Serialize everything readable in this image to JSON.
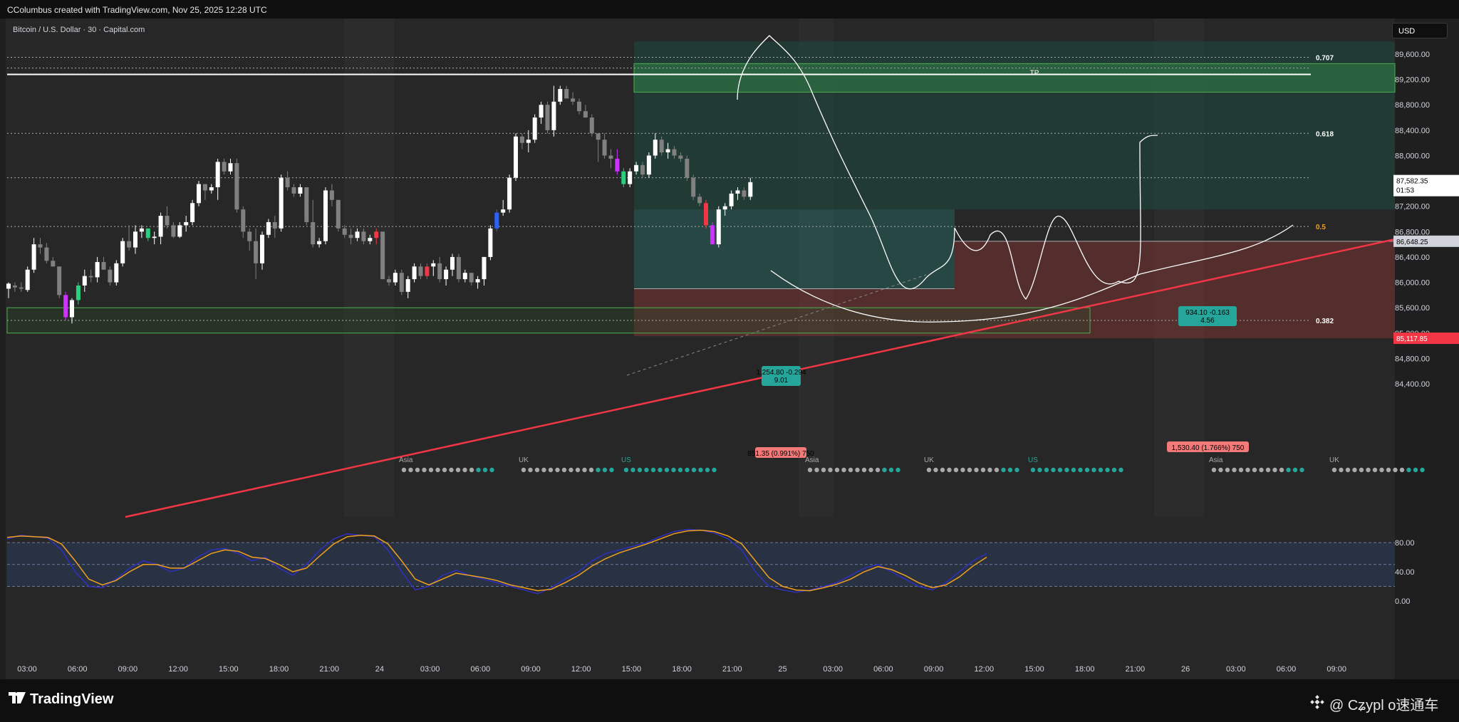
{
  "header": {
    "caption": "CColumbus created with TradingView.com, Nov 25, 2025 12:28 UTC"
  },
  "symbol_title": "Bitcoin / U.S. Dollar · 30 · Capital.com",
  "currency_button": "USD",
  "brand": {
    "name": "TradingView",
    "logo_icon": "tradingview-logo-icon"
  },
  "watermark": {
    "text": "@ Cʑypl o速通车",
    "icon": "binance-diamond-icon"
  },
  "colors": {
    "up": "#ffffff",
    "down": "#808080",
    "bull_strong": "#26d07c",
    "bear_strong": "#f23645",
    "purple": "#cc33ff",
    "blue": "#2962ff",
    "trendline": "#f23645",
    "stoch_k": "#3030c0",
    "stoch_d": "#f0a020"
  },
  "chart_data": {
    "type": "candlestick",
    "y_axis": {
      "range": [
        83900,
        90300
      ],
      "ticks": [
        "89,600.00",
        "89,200.00",
        "88,800.00",
        "88,400.00",
        "88,000.00",
        "87,600.00",
        "87,200.00",
        "86,800.00",
        "86,400.00",
        "86,000.00",
        "85,600.00",
        "85,200.00",
        "84,800.00",
        "84,400.00"
      ],
      "current_price": "87,582.35",
      "countdown": "01:53",
      "price_labels": [
        {
          "value": "86,648.25",
          "color": "#d1d4dc"
        },
        {
          "value": "85,117.85",
          "color": "#f23645"
        }
      ]
    },
    "x_axis": {
      "ticks": [
        "03:00",
        "06:00",
        "09:00",
        "12:00",
        "15:00",
        "18:00",
        "21:00",
        "24",
        "03:00",
        "06:00",
        "09:00",
        "12:00",
        "15:00",
        "18:00",
        "21:00",
        "25",
        "03:00",
        "06:00",
        "09:00",
        "12:00",
        "15:00",
        "18:00",
        "21:00",
        "26",
        "03:00",
        "06:00",
        "09:00"
      ]
    },
    "candles_ohlc": [
      [
        85900,
        86000,
        85750,
        85980
      ],
      [
        85950,
        86000,
        85850,
        85920
      ],
      [
        85920,
        86000,
        85850,
        85900
      ],
      [
        85880,
        86250,
        85850,
        86200
      ],
      [
        86200,
        86700,
        86150,
        86600
      ],
      [
        86600,
        86700,
        86450,
        86550
      ],
      [
        86550,
        86620,
        86300,
        86340
      ],
      [
        86340,
        86400,
        86250,
        86250
      ],
      [
        86250,
        86200,
        85750,
        85800
      ],
      [
        85800,
        85850,
        85400,
        85450
      ],
      [
        85450,
        85750,
        85350,
        85720
      ],
      [
        85720,
        86000,
        85650,
        85950
      ],
      [
        85950,
        86200,
        85850,
        86100
      ],
      [
        86100,
        86200,
        86000,
        86080
      ],
      [
        86080,
        86400,
        86000,
        86320
      ],
      [
        86320,
        86400,
        86200,
        86200
      ],
      [
        86200,
        86250,
        85950,
        86000
      ],
      [
        86000,
        86350,
        85950,
        86300
      ],
      [
        86300,
        86700,
        86250,
        86650
      ],
      [
        86650,
        86900,
        86500,
        86550
      ],
      [
        86550,
        86900,
        86450,
        86800
      ],
      [
        86800,
        86900,
        86700,
        86850
      ],
      [
        86850,
        86850,
        86650,
        86700
      ],
      [
        86700,
        86800,
        86600,
        86720
      ],
      [
        86720,
        87100,
        86600,
        87050
      ],
      [
        87050,
        87200,
        86850,
        86900
      ],
      [
        86900,
        86950,
        86700,
        86720
      ],
      [
        86720,
        86950,
        86700,
        86900
      ],
      [
        86900,
        87050,
        86800,
        86950
      ],
      [
        86950,
        87300,
        86900,
        87250
      ],
      [
        87250,
        87600,
        87200,
        87550
      ],
      [
        87550,
        87500,
        87300,
        87450
      ],
      [
        87450,
        87550,
        87400,
        87500
      ],
      [
        87500,
        87950,
        87300,
        87900
      ],
      [
        87900,
        87950,
        87700,
        87750
      ],
      [
        87750,
        87950,
        87700,
        87880
      ],
      [
        87880,
        87950,
        87100,
        87150
      ],
      [
        87150,
        87200,
        86700,
        86800
      ],
      [
        86800,
        86850,
        86500,
        86650
      ],
      [
        86650,
        86850,
        86050,
        86300
      ],
      [
        86300,
        86800,
        86200,
        86750
      ],
      [
        86750,
        87000,
        86700,
        86950
      ],
      [
        86950,
        87050,
        86700,
        86850
      ],
      [
        86850,
        87700,
        86800,
        87650
      ],
      [
        87650,
        87750,
        87450,
        87500
      ],
      [
        87500,
        87550,
        87350,
        87400
      ],
      [
        87400,
        87550,
        87350,
        87500
      ],
      [
        87500,
        87500,
        86900,
        86950
      ],
      [
        86950,
        87300,
        86550,
        86600
      ],
      [
        86600,
        86700,
        86550,
        86650
      ],
      [
        86650,
        87500,
        86600,
        87450
      ],
      [
        87450,
        87550,
        87200,
        87300
      ],
      [
        87300,
        87300,
        86800,
        86850
      ],
      [
        86850,
        86900,
        86700,
        86750
      ],
      [
        86750,
        86850,
        86600,
        86700
      ],
      [
        86700,
        86850,
        86650,
        86800
      ],
      [
        86800,
        86850,
        86600,
        86650
      ],
      [
        86650,
        86750,
        86600,
        86700
      ],
      [
        86700,
        86850,
        86600,
        86800
      ],
      [
        86800,
        86800,
        86050,
        86050
      ],
      [
        86050,
        86100,
        85950,
        86000
      ],
      [
        86000,
        86200,
        85950,
        86150
      ],
      [
        86150,
        86200,
        85800,
        85850
      ],
      [
        85850,
        86100,
        85750,
        86050
      ],
      [
        86050,
        86300,
        86000,
        86250
      ],
      [
        86250,
        86300,
        86050,
        86100
      ],
      [
        86100,
        86300,
        86050,
        86250
      ],
      [
        86250,
        86350,
        86100,
        86300
      ],
      [
        86300,
        86400,
        86000,
        86050
      ],
      [
        86050,
        86250,
        85950,
        86200
      ],
      [
        86200,
        86450,
        86100,
        86400
      ],
      [
        86400,
        86450,
        86000,
        86050
      ],
      [
        86050,
        86200,
        86000,
        86150
      ],
      [
        86150,
        86150,
        85950,
        86000
      ],
      [
        86000,
        86100,
        85900,
        86050
      ],
      [
        86050,
        86400,
        85950,
        86400
      ],
      [
        86400,
        86900,
        86350,
        86850
      ],
      [
        86850,
        87150,
        86800,
        87100
      ],
      [
        87100,
        87300,
        87050,
        87150
      ],
      [
        87150,
        87700,
        87100,
        87650
      ],
      [
        87650,
        88350,
        87600,
        88300
      ],
      [
        88300,
        88350,
        88100,
        88200
      ],
      [
        88200,
        88400,
        88050,
        88250
      ],
      [
        88250,
        88650,
        88200,
        88600
      ],
      [
        88600,
        88850,
        88500,
        88800
      ],
      [
        88800,
        88850,
        88350,
        88400
      ],
      [
        88400,
        89100,
        88300,
        88850
      ],
      [
        88850,
        89100,
        88800,
        89050
      ],
      [
        89050,
        89100,
        88950,
        88900
      ],
      [
        88900,
        89000,
        88800,
        88850
      ],
      [
        88850,
        88900,
        88650,
        88700
      ],
      [
        88700,
        88800,
        88600,
        88600
      ],
      [
        88600,
        88650,
        88300,
        88350
      ],
      [
        88350,
        88250,
        87900,
        88250
      ],
      [
        88250,
        88350,
        87950,
        88000
      ],
      [
        88000,
        88100,
        87800,
        87950
      ],
      [
        87950,
        88100,
        87700,
        87750
      ],
      [
        87750,
        87800,
        87500,
        87550
      ],
      [
        87550,
        87800,
        87500,
        87750
      ],
      [
        87750,
        87900,
        87700,
        87850
      ],
      [
        87850,
        87900,
        87650,
        87700
      ],
      [
        87700,
        88050,
        87650,
        88000
      ],
      [
        88000,
        88350,
        87950,
        88250
      ],
      [
        88250,
        88300,
        88000,
        88050
      ],
      [
        88050,
        88200,
        87950,
        88100
      ],
      [
        88100,
        88150,
        87950,
        88000
      ],
      [
        88000,
        88050,
        87900,
        87950
      ],
      [
        87950,
        88000,
        87600,
        87650
      ],
      [
        87650,
        87700,
        87300,
        87350
      ],
      [
        87350,
        87400,
        87200,
        87250
      ],
      [
        87250,
        87300,
        86850,
        86900
      ],
      [
        86900,
        86950,
        86600,
        86600
      ],
      [
        86600,
        87200,
        86550,
        87150
      ],
      [
        87150,
        87250,
        87050,
        87200
      ],
      [
        87200,
        87450,
        87150,
        87400
      ],
      [
        87400,
        87500,
        87300,
        87450
      ],
      [
        87450,
        87500,
        87300,
        87350
      ],
      [
        87350,
        87650,
        87300,
        87580
      ]
    ],
    "candle_color_overrides": {
      "9": "purple",
      "11": "bull_strong",
      "22": "bull_strong",
      "58": "bear_strong",
      "66": "bear_strong",
      "77": "blue",
      "96": "purple",
      "97": "bull_strong",
      "110": "bear_strong",
      "111": "purple"
    },
    "horizontal_lines": [
      {
        "price": 89280,
        "style": "solid",
        "color": "#ffffff",
        "label": ""
      },
      {
        "price": 89380,
        "style": "dotted",
        "color": "#aaaaaa",
        "label": ""
      },
      {
        "price": 88350,
        "style": "dotted",
        "color": "#aaaaaa",
        "label": "0.618"
      },
      {
        "price": 89550,
        "style": "dotted",
        "color": "#aaaaaa",
        "label": "0.707"
      },
      {
        "price": 87650,
        "style": "dotted",
        "color": "#aaaaaa",
        "label": ""
      },
      {
        "price": 86880,
        "style": "dotted",
        "color": "#aaaaaa",
        "label": "0.5"
      },
      {
        "price": 85400,
        "style": "dotted",
        "color": "#aaaaaa",
        "label": "0.382"
      }
    ],
    "zones": [
      {
        "name": "tp-zone",
        "from_price": 89000,
        "to_price": 89500,
        "label": "TP",
        "color": "#2e5e3a"
      },
      {
        "name": "demand-zone",
        "from_price": 85200,
        "to_price": 85600,
        "label": "",
        "color": "#2b3a2b"
      },
      {
        "name": "long-position",
        "from_price": 85900,
        "to_price": 87150,
        "label": "1,254.80 ‑0.294\n9.01",
        "color": "#26a69a"
      },
      {
        "name": "long-target-area",
        "from_price": 87150,
        "to_price": 89550,
        "label": "",
        "color": "#1e4a40"
      },
      {
        "name": "stop-area-1",
        "from_price": 85117,
        "to_price": 85900,
        "label": "851.35 (0.991%) 750",
        "color": "#5a2a2a"
      },
      {
        "name": "short-position",
        "from_price": 85117,
        "to_price": 86648,
        "label": "1,530.40 (1.766%) 750",
        "color": "#4a2a2a"
      },
      {
        "name": "target-bar",
        "from_price": 86648,
        "to_price": 86648,
        "label": "934.10 ‑0.163\n4.56",
        "color": "#26a69a"
      }
    ],
    "session_labels": [
      "Asia",
      "UK",
      "US",
      "Asia",
      "UK",
      "US",
      "Asia",
      "UK"
    ],
    "stochastic": {
      "levels": [
        "80.00",
        "40.00",
        "0.00"
      ],
      "k": [
        85,
        90,
        88,
        86,
        70,
        40,
        20,
        18,
        30,
        45,
        55,
        50,
        40,
        45,
        60,
        70,
        72,
        65,
        55,
        60,
        45,
        35,
        50,
        70,
        85,
        92,
        90,
        88,
        70,
        40,
        15,
        20,
        35,
        42,
        35,
        30,
        25,
        20,
        15,
        10,
        18,
        30,
        40,
        55,
        65,
        70,
        75,
        80,
        88,
        95,
        98,
        97,
        93,
        85,
        70,
        40,
        20,
        15,
        12,
        15,
        20,
        25,
        35,
        45,
        50,
        40,
        30,
        20,
        15,
        25,
        40,
        55,
        65
      ],
      "d": [
        87,
        89,
        88,
        87,
        78,
        55,
        30,
        22,
        28,
        40,
        50,
        50,
        45,
        45,
        55,
        65,
        70,
        68,
        60,
        58,
        50,
        40,
        45,
        62,
        78,
        88,
        90,
        89,
        78,
        55,
        30,
        22,
        30,
        38,
        35,
        32,
        28,
        22,
        18,
        14,
        16,
        25,
        35,
        48,
        58,
        66,
        72,
        78,
        85,
        92,
        96,
        97,
        95,
        89,
        78,
        55,
        32,
        20,
        15,
        14,
        18,
        23,
        30,
        40,
        47,
        43,
        35,
        25,
        18,
        22,
        33,
        48,
        60
      ]
    }
  }
}
